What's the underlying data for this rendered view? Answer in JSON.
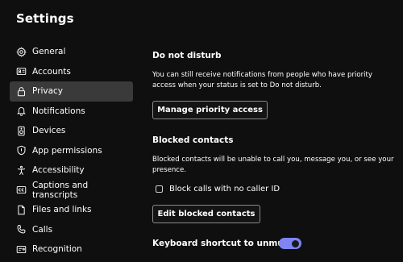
{
  "window": {
    "title": "Settings"
  },
  "sidebar": {
    "items": [
      {
        "label": "General",
        "icon": "gear-icon",
        "selected": false
      },
      {
        "label": "Accounts",
        "icon": "id-card-icon",
        "selected": false
      },
      {
        "label": "Privacy",
        "icon": "lock-icon",
        "selected": true
      },
      {
        "label": "Notifications",
        "icon": "bell-icon",
        "selected": false
      },
      {
        "label": "Devices",
        "icon": "speaker-icon",
        "selected": false
      },
      {
        "label": "App permissions",
        "icon": "shield-icon",
        "selected": false
      },
      {
        "label": "Accessibility",
        "icon": "accessibility-icon",
        "selected": false
      },
      {
        "label": "Captions and transcripts",
        "icon": "cc-icon",
        "selected": false
      },
      {
        "label": "Files and links",
        "icon": "file-icon",
        "selected": false
      },
      {
        "label": "Calls",
        "icon": "phone-icon",
        "selected": false
      },
      {
        "label": "Recognition",
        "icon": "id-badge-icon",
        "selected": false
      }
    ]
  },
  "main": {
    "dnd": {
      "title": "Do not disturb",
      "description": "You can still receive notifications from people who have priority access when your status is set to Do not disturb.",
      "button_label": "Manage priority access"
    },
    "blocked": {
      "title": "Blocked contacts",
      "description": "Blocked contacts will be unable to call you, message you, or see your presence.",
      "checkbox_label": "Block calls with no caller ID",
      "checkbox_checked": false,
      "button_label": "Edit blocked contacts"
    },
    "keyboard": {
      "title": "Keyboard shortcut to unmute",
      "toggle_on": true
    }
  },
  "colors": {
    "background": "#0f0f0f",
    "selected_item": "#3a3a3a",
    "accent": "#7f85f5"
  }
}
